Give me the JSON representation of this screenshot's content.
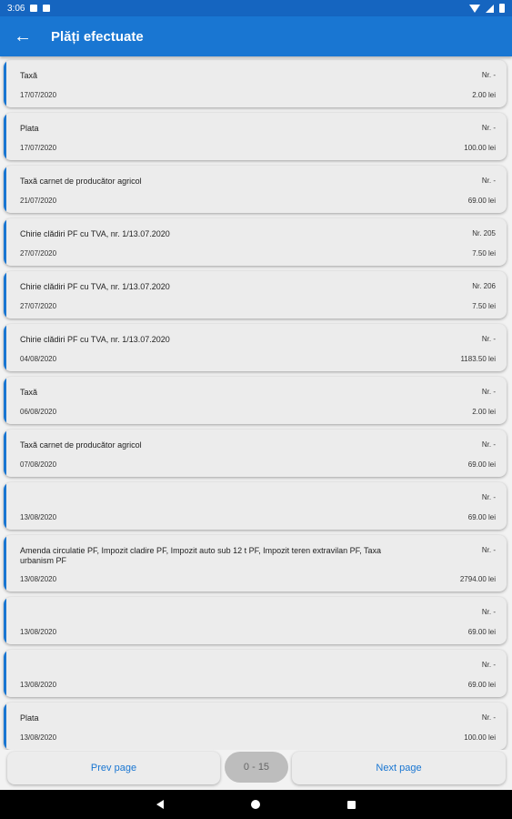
{
  "status_bar": {
    "time": "3:06"
  },
  "app_bar": {
    "title": "Plăți efectuate",
    "back_icon": "arrow-back-icon"
  },
  "payments": [
    {
      "description": "Taxă",
      "date": "17/07/2020",
      "nr": "Nr. -",
      "amount": "2.00 lei"
    },
    {
      "description": "Plata",
      "date": "17/07/2020",
      "nr": "Nr. -",
      "amount": "100.00 lei"
    },
    {
      "description": "Taxă carnet de producător agricol",
      "date": "21/07/2020",
      "nr": "Nr. -",
      "amount": "69.00 lei"
    },
    {
      "description": "Chirie clădiri PF cu TVA, nr. 1/13.07.2020",
      "date": "27/07/2020",
      "nr": "Nr. 205",
      "amount": "7.50 lei"
    },
    {
      "description": "Chirie clădiri PF cu TVA, nr. 1/13.07.2020",
      "date": "27/07/2020",
      "nr": "Nr. 206",
      "amount": "7.50 lei"
    },
    {
      "description": "Chirie clădiri PF cu TVA, nr. 1/13.07.2020",
      "date": "04/08/2020",
      "nr": "Nr. -",
      "amount": "1183.50 lei"
    },
    {
      "description": "Taxă",
      "date": "06/08/2020",
      "nr": "Nr. -",
      "amount": "2.00 lei"
    },
    {
      "description": "Taxă carnet de producător agricol",
      "date": "07/08/2020",
      "nr": "Nr. -",
      "amount": "69.00 lei"
    },
    {
      "description": "",
      "date": "13/08/2020",
      "nr": "Nr. -",
      "amount": "69.00 lei"
    },
    {
      "description": "Amenda circulatie PF, Impozit cladire PF, Impozit auto sub 12 t PF, Impozit teren extravilan PF, Taxa urbanism PF",
      "date": "13/08/2020",
      "nr": "Nr. -",
      "amount": "2794.00 lei"
    },
    {
      "description": "",
      "date": "13/08/2020",
      "nr": "Nr. -",
      "amount": "69.00 lei"
    },
    {
      "description": "",
      "date": "13/08/2020",
      "nr": "Nr. -",
      "amount": "69.00 lei"
    },
    {
      "description": "Plata",
      "date": "13/08/2020",
      "nr": "Nr. -",
      "amount": "100.00 lei"
    }
  ],
  "pager": {
    "prev_label": "Prev page",
    "range_label": "0 - 15",
    "next_label": "Next page"
  },
  "colors": {
    "primary": "#1976d2",
    "status_bar": "#1565c0"
  }
}
